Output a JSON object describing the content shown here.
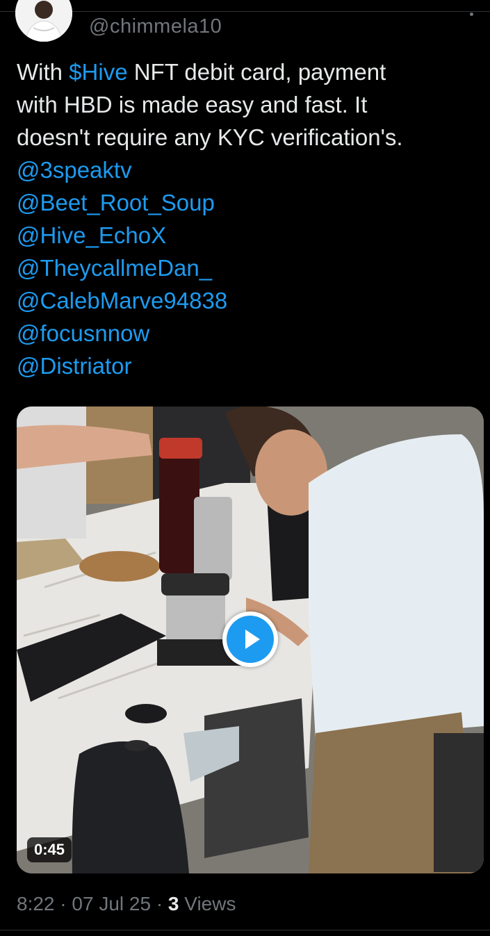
{
  "author": {
    "handle": "@chimmela10"
  },
  "tweet": {
    "text_before": "With ",
    "cashtag": "$Hive",
    "text_line1_rest": " NFT debit card, payment",
    "text_line2": "with HBD is made easy and fast. It",
    "text_line3": "doesn't require any KYC verification's.",
    "mentions": [
      "@3speaktv",
      "@Beet_Root_Soup",
      "@Hive_EchoX",
      "@TheycallmeDan_",
      "@CalebMarve94838",
      "@focusnnow",
      "@Distriator"
    ]
  },
  "media": {
    "duration": "0:45",
    "play_icon": "play-icon"
  },
  "meta": {
    "time": "8:22",
    "separator": "·",
    "date": "07 Jul 25",
    "view_count": "3",
    "views_label": "Views"
  },
  "colors": {
    "background": "#000000",
    "text": "#e7e9ea",
    "muted": "#71767b",
    "link": "#1d9bf0",
    "divider": "#2f3336"
  }
}
